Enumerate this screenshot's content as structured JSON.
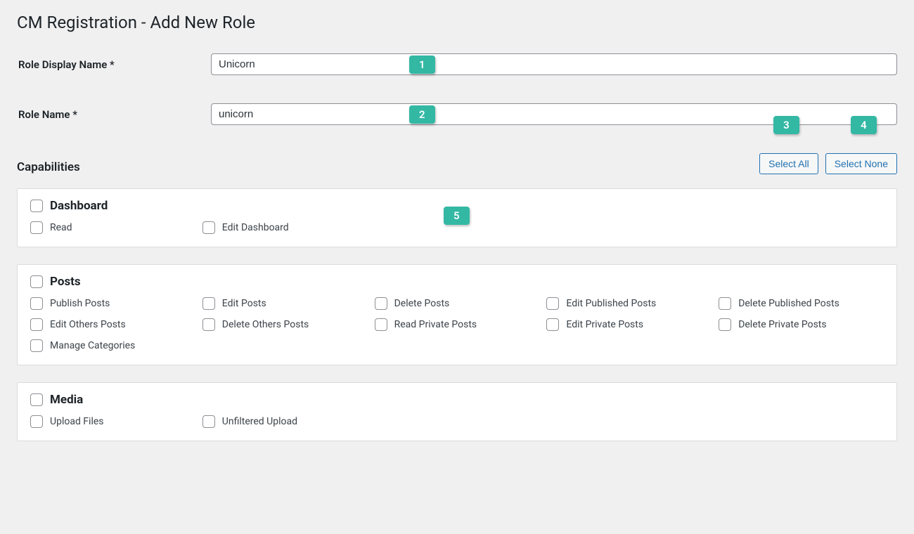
{
  "page_title": "CM Registration - Add New Role",
  "fields": {
    "display_name_label": "Role Display Name *",
    "display_name_value": "Unicorn",
    "role_name_label": "Role Name *",
    "role_name_value": "unicorn"
  },
  "capabilities_label": "Capabilities",
  "buttons": {
    "select_all": "Select All",
    "select_none": "Select None"
  },
  "badges": {
    "b1": "1",
    "b2": "2",
    "b3": "3",
    "b4": "4",
    "b5": "5"
  },
  "sections": [
    {
      "title": "Dashboard",
      "caps": [
        "Read",
        "Edit Dashboard"
      ]
    },
    {
      "title": "Posts",
      "caps": [
        "Publish Posts",
        "Edit Posts",
        "Delete Posts",
        "Edit Published Posts",
        "Delete Published Posts",
        "Edit Others Posts",
        "Delete Others Posts",
        "Read Private Posts",
        "Edit Private Posts",
        "Delete Private Posts",
        "Manage Categories"
      ]
    },
    {
      "title": "Media",
      "caps": [
        "Upload Files",
        "Unfiltered Upload"
      ]
    }
  ]
}
